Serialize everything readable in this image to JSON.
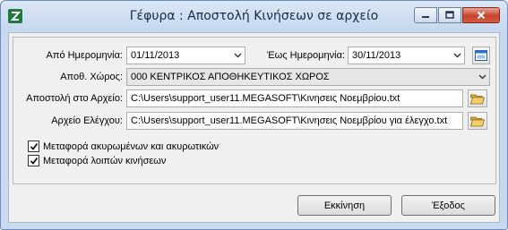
{
  "window": {
    "title": "Γέφυρα : Αποστολή Κινήσεων σε αρχείο",
    "icon": "app-z-icon"
  },
  "form": {
    "from_date_label": "Από Ημερομηνία:",
    "from_date_value": "01/11/2013",
    "to_date_label": "Έως Ημερομηνία:",
    "to_date_value": "30/11/2013",
    "calendar_icon": "calendar-window-icon",
    "warehouse_label": "Αποθ. Χώρος:",
    "warehouse_value": "000  ΚΕΝΤΡΙΚΟΣ ΑΠΟΘΗΚΕΥΤΙΚΟΣ ΧΩΡΟΣ",
    "send_file_label": "Αποστολή στο Αρχείο:",
    "send_file_value": "C:\\Users\\support_user11.MEGASOFT\\Κινησεις Νοεμβρίου.txt",
    "check_file_label": "Αρχείο Ελέγχου:",
    "check_file_value": "C:\\Users\\support_user11.MEGASOFT\\Κινησεις Νοεμβρίου για έλεγχο.txt",
    "folder_icon": "folder-open-icon"
  },
  "options": [
    {
      "label": "Μεταφορά ακυρωμένων και ακυρωτικών",
      "checked": true
    },
    {
      "label": "Μεταφορά λοιπών κινήσεων",
      "checked": true
    }
  ],
  "buttons": {
    "start": "Εκκίνηση",
    "exit": "Έξοδος"
  }
}
